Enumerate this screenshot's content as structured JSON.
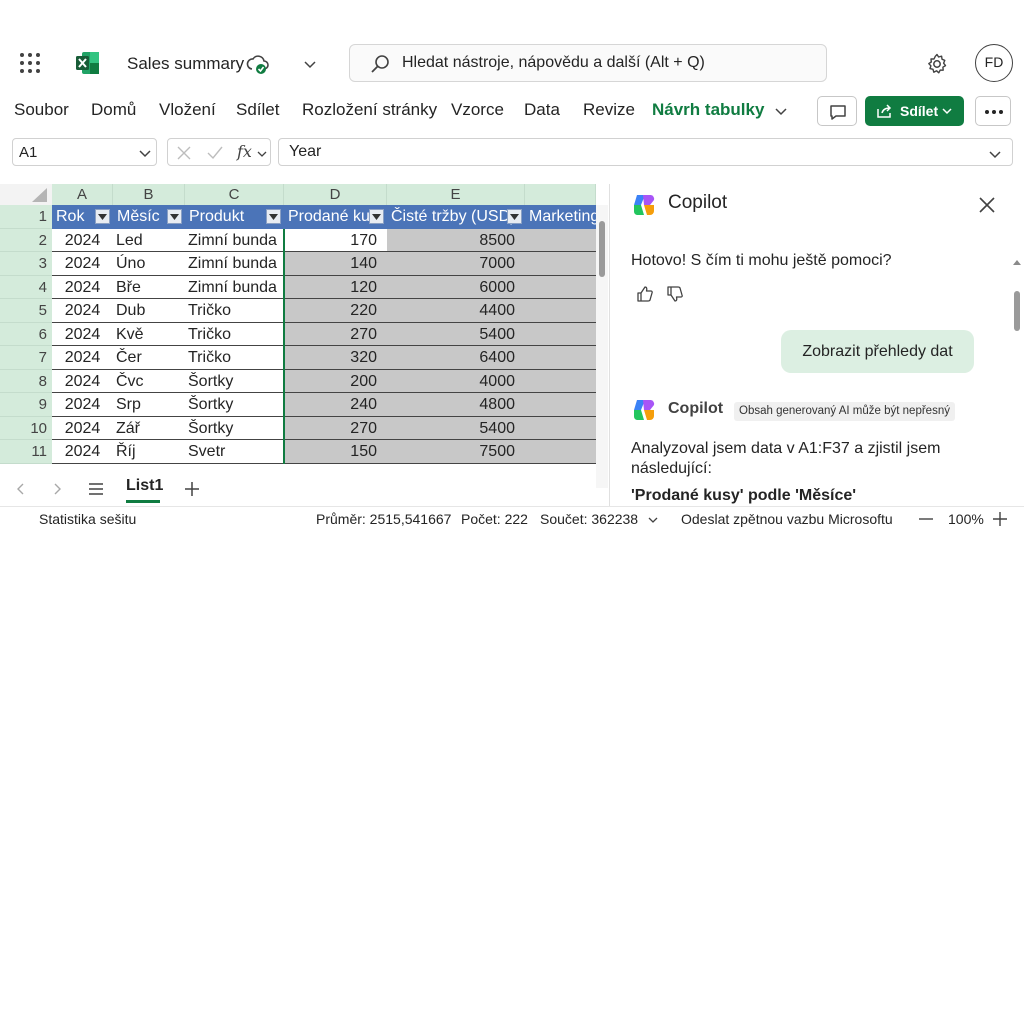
{
  "titlebar": {
    "doc_title": "Sales summary",
    "search_placeholder": "Hledat nástroje, nápovědu a další (Alt + Q)",
    "avatar_initials": "FD"
  },
  "ribbon": {
    "tabs": [
      "Soubor",
      "Domů",
      "Vložení",
      "Sdílet",
      "Rozložení stránky",
      "Vzorce",
      "Data",
      "Revize",
      "Návrh tabulky"
    ],
    "active_tab": "Návrh tabulky",
    "share_label": "Sdílet"
  },
  "formula_bar": {
    "name_box": "A1",
    "formula": "Year",
    "fx_label": "fx"
  },
  "grid": {
    "column_letters": [
      "A",
      "B",
      "C",
      "D",
      "E",
      ""
    ],
    "row_numbers": [
      "1",
      "2",
      "3",
      "4",
      "5",
      "6",
      "7",
      "8",
      "9",
      "10",
      "11"
    ],
    "headers": [
      "Rok",
      "Měsíc",
      "Produkt",
      "Prodané ku",
      "Čisté tržby (USD)",
      "Marketing"
    ],
    "rows": [
      [
        "2024",
        "Led",
        "Zimní bunda",
        "170",
        "8500"
      ],
      [
        "2024",
        "Úno",
        "Zimní bunda",
        "140",
        "7000"
      ],
      [
        "2024",
        "Bře",
        "Zimní bunda",
        "120",
        "6000"
      ],
      [
        "2024",
        "Dub",
        "Tričko",
        "220",
        "4400"
      ],
      [
        "2024",
        "Kvě",
        "Tričko",
        "270",
        "5400"
      ],
      [
        "2024",
        "Čer",
        "Tričko",
        "320",
        "6400"
      ],
      [
        "2024",
        "Čvc",
        "Šortky",
        "200",
        "4000"
      ],
      [
        "2024",
        "Srp",
        "Šortky",
        "240",
        "4800"
      ],
      [
        "2024",
        "Zář",
        "Šortky",
        "270",
        "5400"
      ],
      [
        "2024",
        "Říj",
        "Svetr",
        "150",
        "7500"
      ]
    ]
  },
  "sheets": {
    "active": "List1"
  },
  "copilot": {
    "title": "Copilot",
    "message1": "Hotovo! S čím ti mohu ještě pomoci?",
    "suggestion": "Zobrazit přehledy dat",
    "name2": "Copilot",
    "ai_badge": "Obsah generovaný AI může být nepřesný",
    "analysis_line1": "Analyzoval jsem data v A1:F37 a zjistil jsem",
    "analysis_line2": "následující:",
    "section_title": "'Prodané kusy' podle 'Měsíce'"
  },
  "statusbar": {
    "workbook_stats": "Statistika sešitu",
    "average": "Průměr: 2515,541667",
    "count": "Počet: 222",
    "sum": "Součet: 362238",
    "feedback": "Odeslat zpětnou vazbu Microsoftu",
    "zoom": "100%"
  },
  "colors": {
    "excel_green": "#107c41",
    "table_header_blue": "#4b74b8",
    "header_green": "#d4ebdb",
    "selection_gray": "#c8c8c8",
    "suggestion_bg": "#dcefe2"
  },
  "icons": [
    "waffle-icon",
    "excel-logo-icon",
    "cloud-check-icon",
    "search-icon",
    "gear-icon",
    "comment-icon",
    "share-icon",
    "more-icon",
    "close-icon",
    "thumbs-up-icon",
    "thumbs-down-icon",
    "copilot-logo-icon",
    "filter-icon",
    "plus-icon",
    "menu-icon",
    "minus-icon"
  ]
}
